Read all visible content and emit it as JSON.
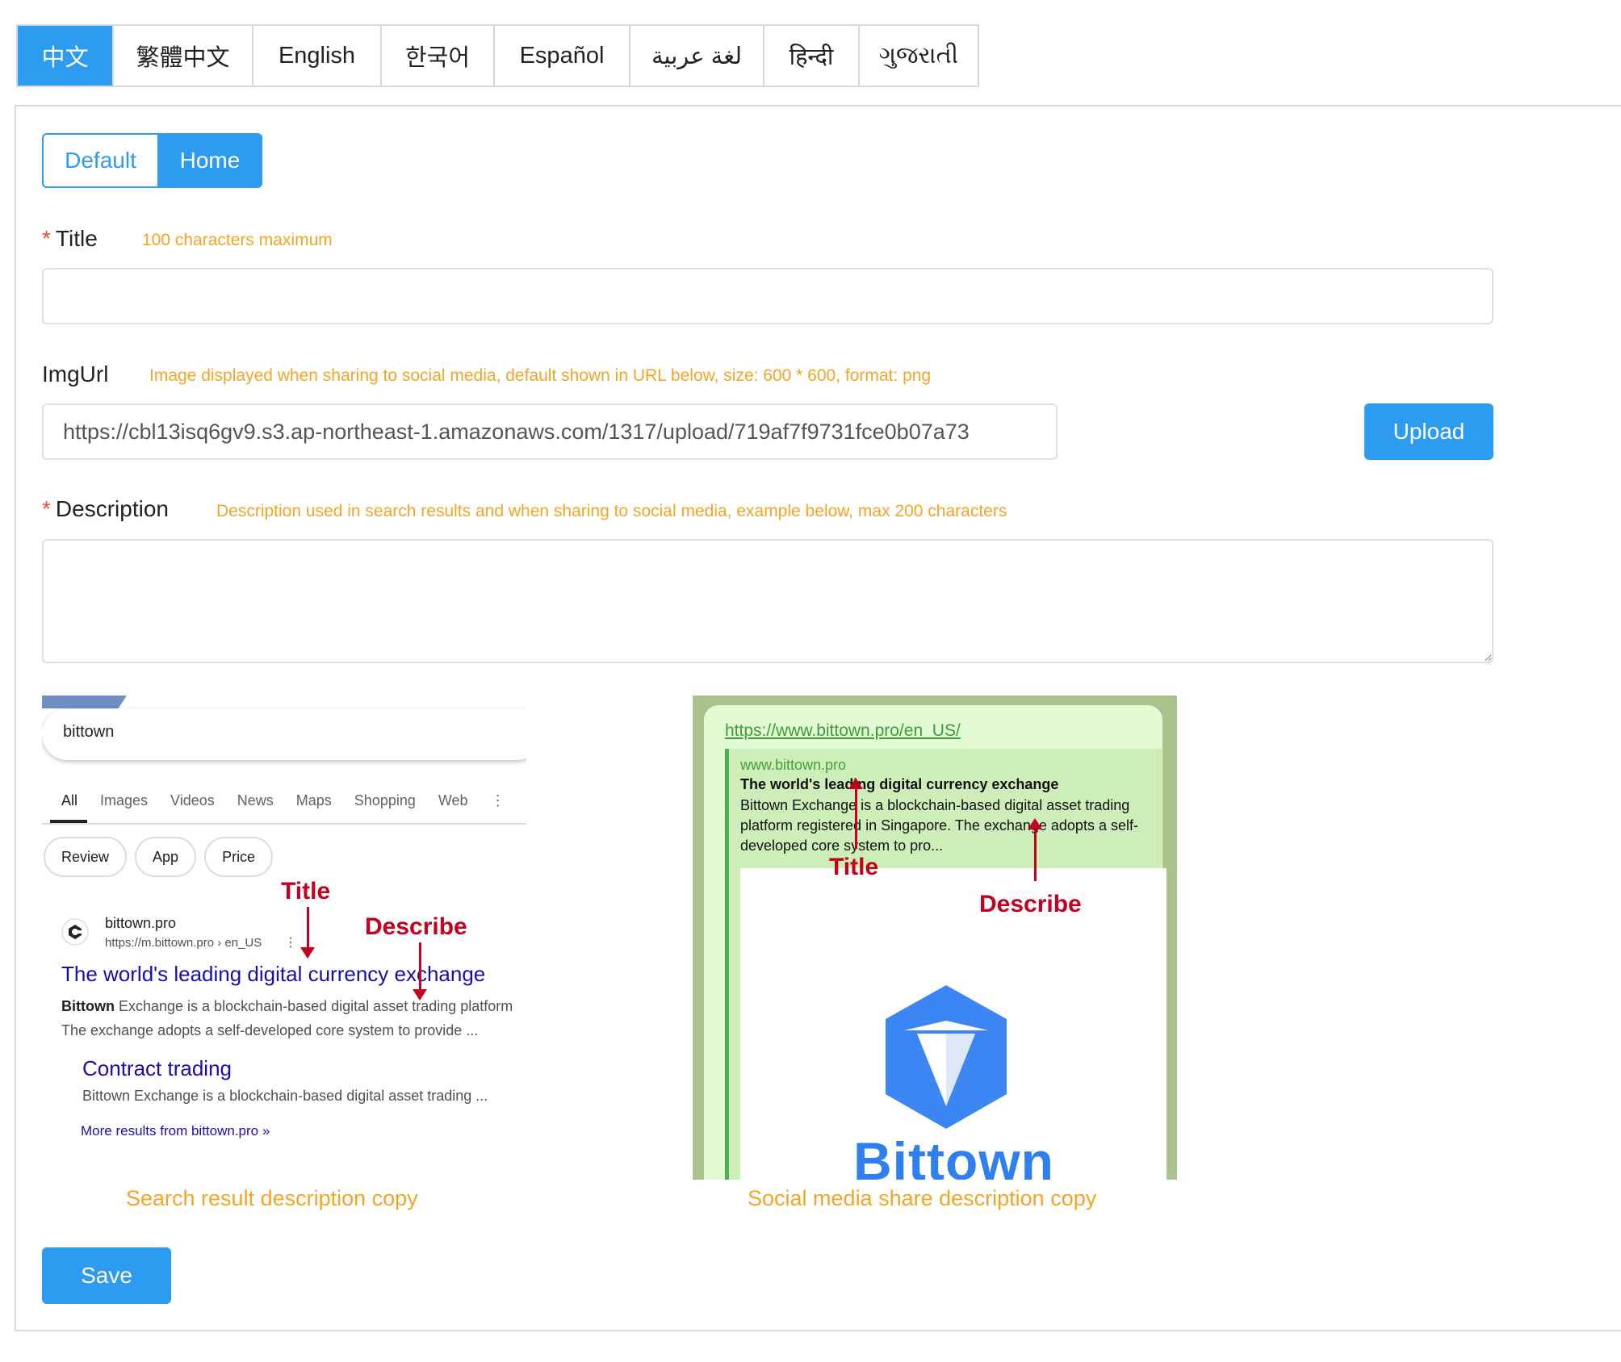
{
  "languages": {
    "tabs": [
      {
        "label": "中文",
        "active": true
      },
      {
        "label": "繁體中文",
        "active": false
      },
      {
        "label": "English",
        "active": false
      },
      {
        "label": "한국어",
        "active": false
      },
      {
        "label": "Español",
        "active": false
      },
      {
        "label": "لغة عربية",
        "active": false
      },
      {
        "label": "हिन्दी",
        "active": false
      },
      {
        "label": "ગુજરાતી",
        "active": false
      }
    ]
  },
  "page_toggle": {
    "default_label": "Default",
    "home_label": "Home",
    "selected": "Home"
  },
  "form": {
    "title": {
      "required_mark": "*",
      "label": "Title",
      "hint": "100 characters maximum",
      "value": ""
    },
    "imgurl": {
      "label": "ImgUrl",
      "hint": "Image displayed when sharing to social media, default shown in URL below, size: 600 * 600, format: png",
      "value": "https://cbl13isq6gv9.s3.ap-northeast-1.amazonaws.com/1317/upload/719af7f9731fce0b07a73",
      "upload_label": "Upload"
    },
    "description": {
      "required_mark": "*",
      "label": "Description",
      "hint": "Description used in search results and when sharing to social media, example below, max 200 characters",
      "value": ""
    },
    "save_label": "Save"
  },
  "search_preview": {
    "query": "bittown",
    "tabs": [
      "All",
      "Images",
      "Videos",
      "News",
      "Maps",
      "Shopping",
      "Web",
      "⋮"
    ],
    "chips": [
      "Review",
      "App",
      "Price"
    ],
    "site_name": "bittown.pro",
    "site_url": "https://m.bittown.pro › en_US",
    "kebab": "⋮",
    "result_title": "The world's leading digital currency exchange",
    "snippet_bold": "Bittown",
    "snippet_line1_rest": " Exchange is a blockchain-based digital asset trading platform",
    "snippet_line2": "The exchange adopts a self-developed core system to provide ...",
    "sub_title": "Contract trading",
    "sub_snippet": "Bittown Exchange is a blockchain-based digital asset trading ...",
    "more_link": "More results from bittown.pro »",
    "annot_title": "Title",
    "annot_describe": "Describe",
    "caption": "Search result description copy"
  },
  "social_preview": {
    "link": "https://www.bittown.pro/en_US/",
    "site": "www.bittown.pro",
    "title": "The world's leading digital currency exchange",
    "description": "Bittown Exchange is a blockchain-based digital asset trading platform registered in Singapore. The exchange adopts a self-developed core system to pro...",
    "logo_text": "Bittown",
    "annot_title": "Title",
    "annot_describe": "Describe",
    "caption": "Social media share description copy"
  },
  "colors": {
    "primary": "#2d9bf0",
    "hint": "#f2a526",
    "required": "#e8503a",
    "annotation": "#c3001d"
  }
}
